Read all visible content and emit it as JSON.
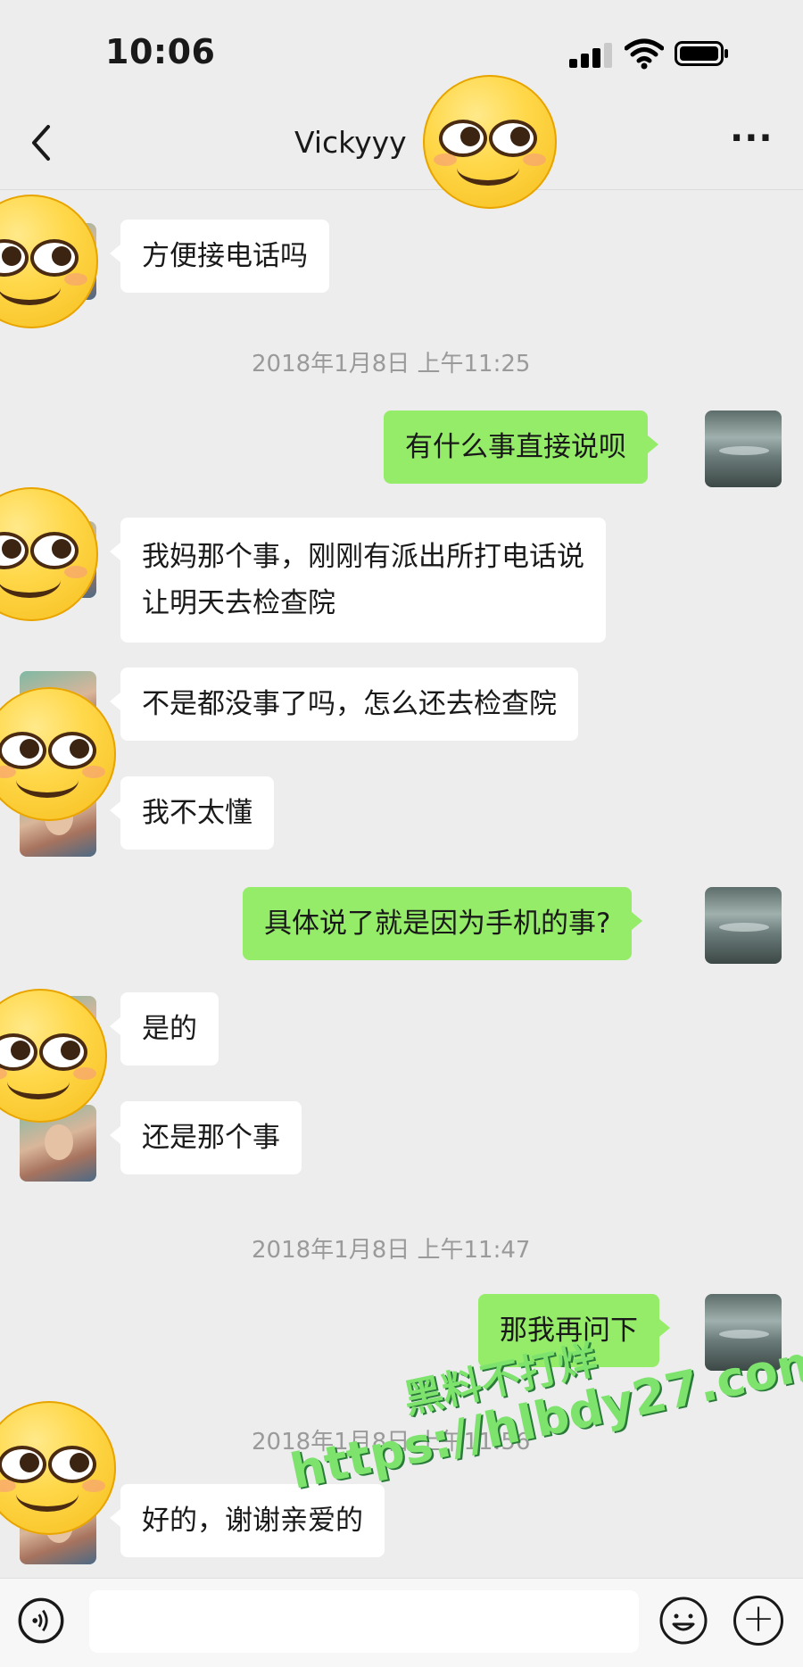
{
  "status_bar": {
    "time": "10:06"
  },
  "nav": {
    "title": "Vickyyy",
    "back_icon": "chevron-left-icon",
    "more_label": "···"
  },
  "messages": [
    {
      "from": "them",
      "text": "方便接电话吗"
    },
    {
      "type": "timestamp",
      "text": "2018年1月8日 上午11:25"
    },
    {
      "from": "me",
      "text": "有什么事直接说呗"
    },
    {
      "from": "them",
      "line1": "我妈那个事，刚刚有派出所打电话说",
      "line2": "让明天去检查院"
    },
    {
      "from": "them",
      "text": "不是都没事了吗，怎么还去检查院"
    },
    {
      "from": "them",
      "text": "我不太懂"
    },
    {
      "from": "me",
      "text": "具体说了就是因为手机的事?"
    },
    {
      "from": "them",
      "text": "是的"
    },
    {
      "from": "them",
      "text": "还是那个事"
    },
    {
      "type": "timestamp",
      "text": "2018年1月8日 上午11:47"
    },
    {
      "from": "me",
      "text": "那我再问下"
    },
    {
      "type": "timestamp",
      "text": "2018年1月8日 上午11:56"
    },
    {
      "from": "them",
      "text": "好的，谢谢亲爱的"
    }
  ],
  "watermark": {
    "line1": "黑料不打烊",
    "line2": "https://hlbdy27.com"
  },
  "bottom_bar": {
    "voice_icon": "voice-icon",
    "emoji_icon": "emoji-icon",
    "plus_label": "+"
  },
  "colors": {
    "background": "#ededed",
    "outgoing_bubble": "#95ec69",
    "incoming_bubble": "#ffffff",
    "timestamp": "#9a9a9a"
  }
}
